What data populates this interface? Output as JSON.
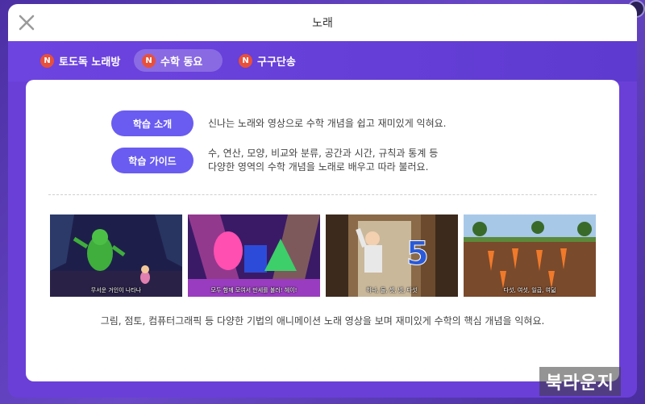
{
  "modal": {
    "title": "노래"
  },
  "tabs": [
    {
      "label": "토도독 노래방",
      "badge": "N",
      "active": false
    },
    {
      "label": "수학 동요",
      "badge": "N",
      "active": true
    },
    {
      "label": "구구단송",
      "badge": "N",
      "active": false
    }
  ],
  "info": {
    "intro_label": "학습 소개",
    "intro_text": "신나는 노래와 영상으로 수학 개념을 쉽고 재미있게 익혀요.",
    "guide_label": "학습 가이드",
    "guide_text_1": "수, 연산, 모양, 비교와 분류, 공간과 시간, 규칙과 통계 등",
    "guide_text_2": "다양한 영역의 수학 개념을 노래로 배우고 따라 불러요."
  },
  "thumbnails": [
    {
      "subtitle": "무서운 거인이 나타나"
    },
    {
      "subtitle": "모두 함께 모여서 만세를 불러! 헤이!"
    },
    {
      "subtitle": "하나, 둘, 셋, 넷, 다섯",
      "number": "5"
    },
    {
      "subtitle": "다섯, 여섯, 일곱, 여덟"
    }
  ],
  "caption": "그림, 점토, 컴퓨터그래픽 등 다양한 기법의 애니메이션 노래 영상을 보며 재미있게 수학의 핵심 개념을 익혀요.",
  "watermark": "북라운지",
  "colors": {
    "accent": "#6a5cf0",
    "tabbar": "#6e44e0",
    "badge": "#e8503a"
  }
}
